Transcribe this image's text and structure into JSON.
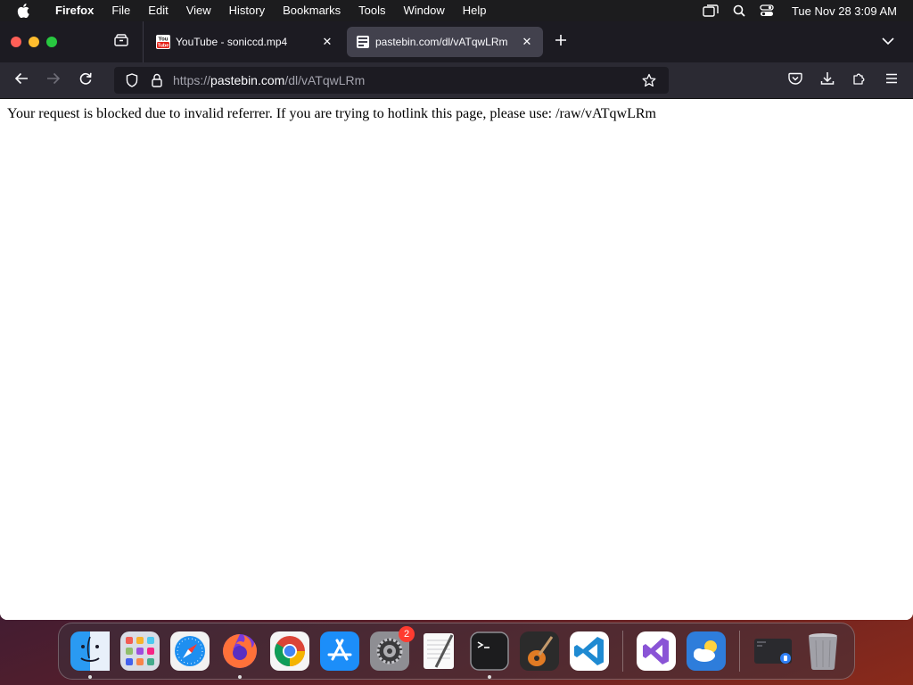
{
  "menubar": {
    "app_name": "Firefox",
    "items": [
      "File",
      "Edit",
      "View",
      "History",
      "Bookmarks",
      "Tools",
      "Window",
      "Help"
    ],
    "clock": "Tue Nov 28  3:09 AM"
  },
  "tabs": [
    {
      "title": "YouTube - soniccd.mp4",
      "favicon": "youtube-icon",
      "active": false
    },
    {
      "title": "pastebin.com/dl/vATqwLRm",
      "favicon": "pastebin-icon",
      "active": true
    }
  ],
  "urlbar": {
    "scheme": "https://",
    "domain": "pastebin.com",
    "path": "/dl/vATqwLRm"
  },
  "page": {
    "message": "Your request is blocked due to invalid referrer. If you are trying to hotlink this page, please use: /raw/vATqwLRm"
  },
  "dock": {
    "items": [
      {
        "name": "Finder",
        "icon": "finder-icon",
        "running": true
      },
      {
        "name": "Launchpad",
        "icon": "launchpad-icon",
        "running": false
      },
      {
        "name": "Safari",
        "icon": "safari-icon",
        "running": false
      },
      {
        "name": "Firefox",
        "icon": "firefox-icon",
        "running": true
      },
      {
        "name": "Chrome",
        "icon": "chrome-icon",
        "running": false
      },
      {
        "name": "App Store",
        "icon": "app-store-icon",
        "running": false
      },
      {
        "name": "System Settings",
        "icon": "system-settings-icon",
        "running": false,
        "badge": "2"
      },
      {
        "name": "TextEdit",
        "icon": "textedit-icon",
        "running": false
      },
      {
        "name": "Terminal",
        "icon": "terminal-icon",
        "running": true
      },
      {
        "name": "GarageBand",
        "icon": "garageband-icon",
        "running": false
      },
      {
        "name": "Visual Studio Code",
        "icon": "vscode-icon",
        "running": false
      },
      {
        "name": "Visual Studio",
        "icon": "visual-studio-icon",
        "running": false
      },
      {
        "name": "Weather",
        "icon": "weather-icon",
        "running": false
      },
      {
        "name": "Screen Recording",
        "icon": "screen-recording-icon",
        "running": false
      },
      {
        "name": "Trash",
        "icon": "trash-icon",
        "running": false
      }
    ]
  },
  "colors": {
    "tabbar_bg": "#1c1b22",
    "navbar_bg": "#2b2a33",
    "active_tab_bg": "#42414d",
    "badge": "#ff3b30"
  }
}
